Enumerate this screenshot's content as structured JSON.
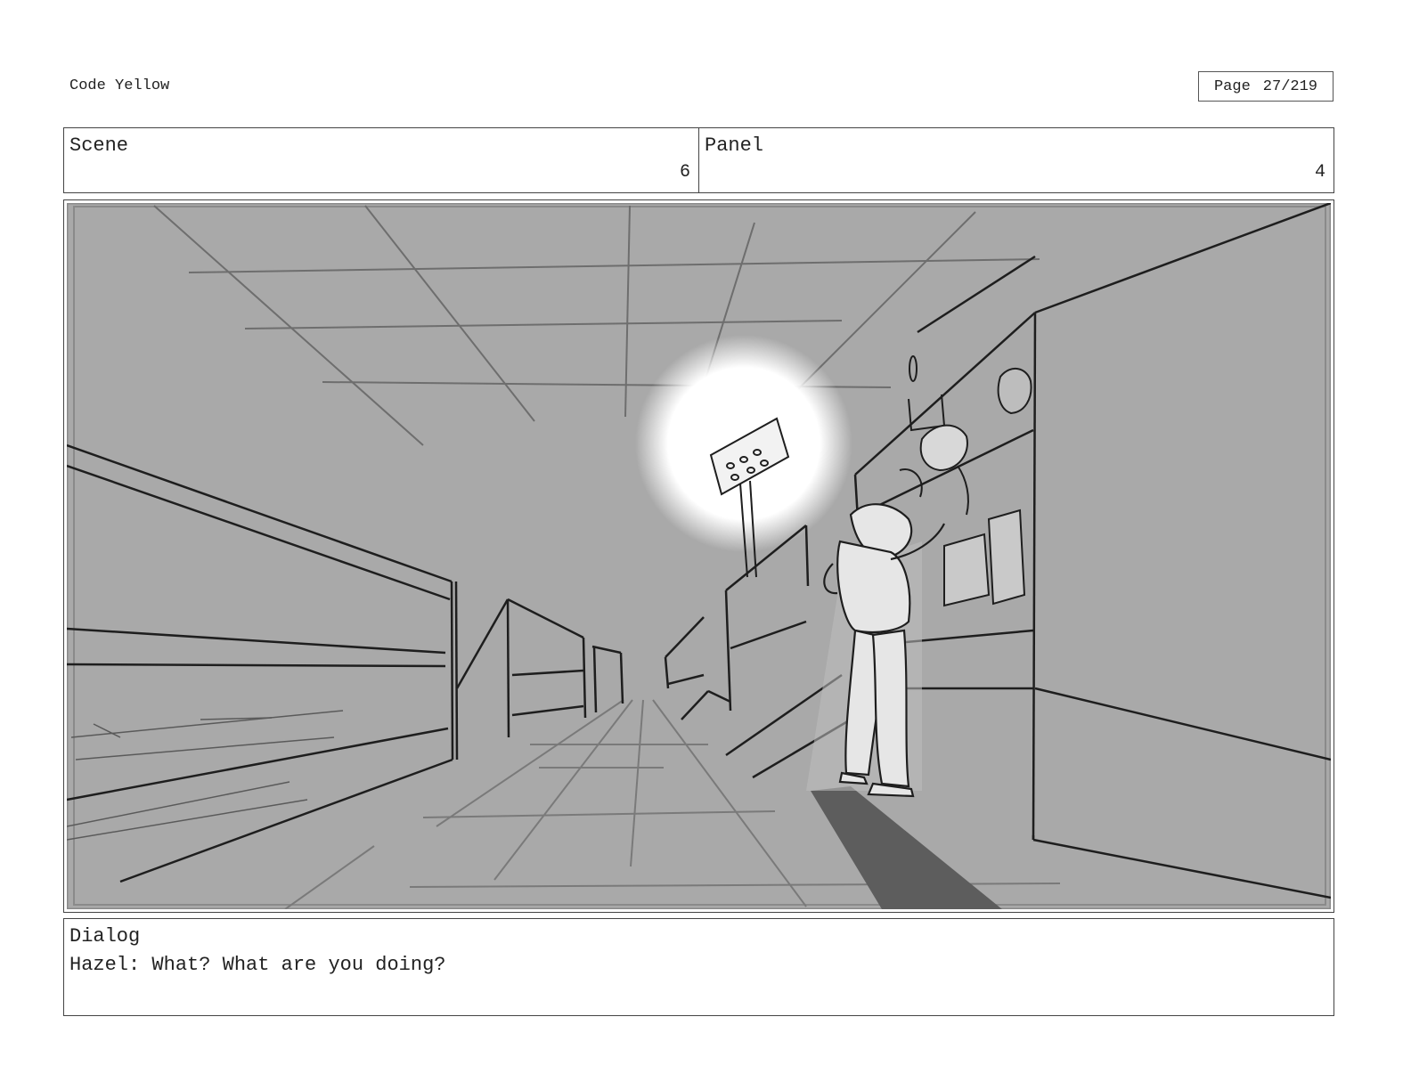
{
  "document": {
    "title": "Code Yellow"
  },
  "page": {
    "label": "Page",
    "number": "27/219"
  },
  "scene": {
    "label": "Scene",
    "value": "6"
  },
  "panel": {
    "label": "Panel",
    "value": "4"
  },
  "dialog": {
    "label": "Dialog",
    "text": "Hazel: What? What are you doing?"
  },
  "colors": {
    "sketch_background": "#a9a9a9",
    "ink": "#1e1e1e",
    "light_glow": "#ffffff"
  }
}
